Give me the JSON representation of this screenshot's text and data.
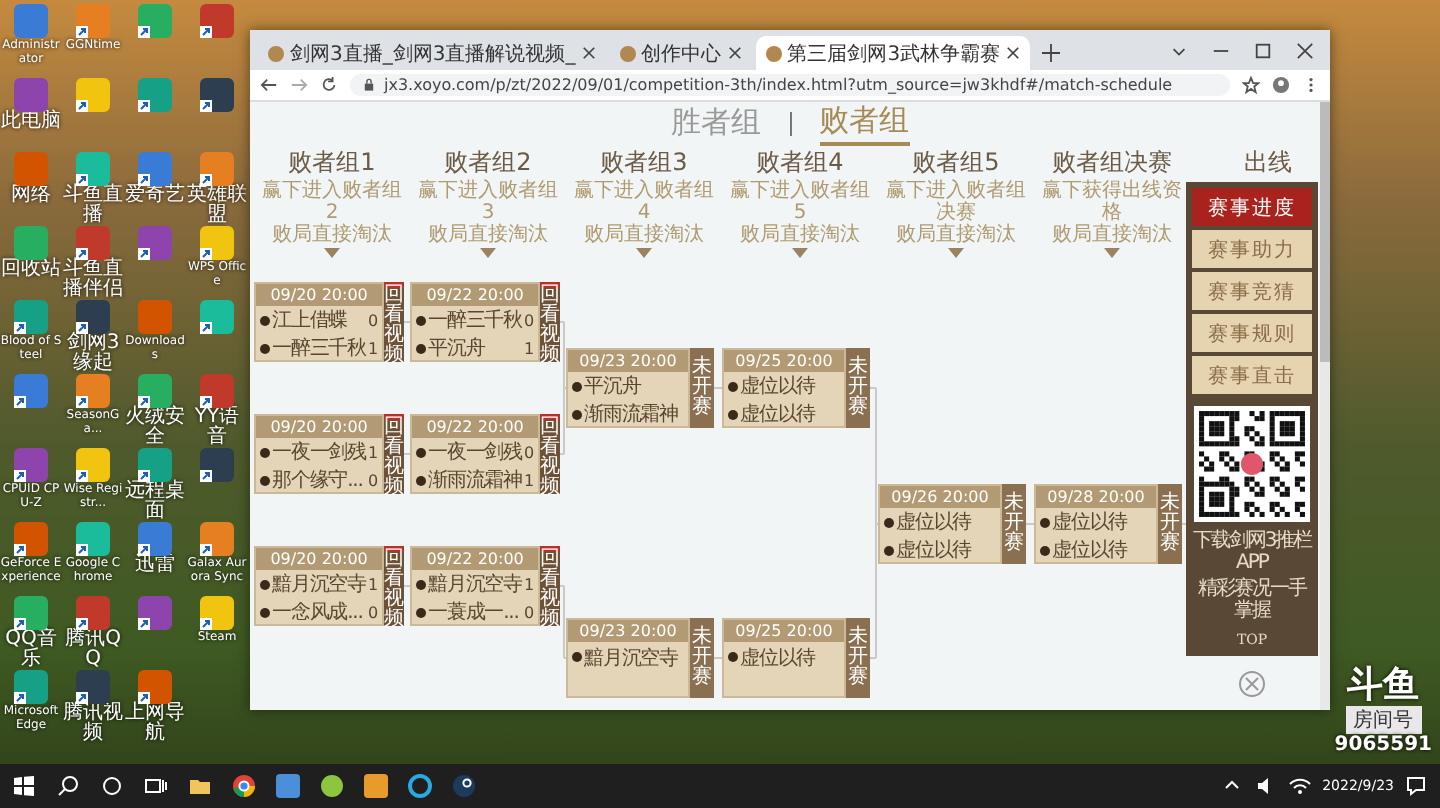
{
  "desktop": {
    "icons": [
      {
        "label": "Administrator",
        "shortcut": false
      },
      {
        "label": "GGNtime",
        "shortcut": true
      },
      {
        "shortcut": true
      },
      {
        "shortcut": true
      },
      {
        "label": "此电脑",
        "shortcut": false
      },
      {
        "shortcut": true
      },
      {
        "shortcut": true
      },
      {
        "shortcut": true
      },
      {
        "label": "网络",
        "shortcut": false
      },
      {
        "label": "斗鱼直播",
        "shortcut": true
      },
      {
        "label": "爱奇艺",
        "shortcut": true
      },
      {
        "label": "英雄联盟",
        "shortcut": true
      },
      {
        "label": "回收站",
        "shortcut": false
      },
      {
        "label": "斗鱼直播伴侣",
        "shortcut": true
      },
      {
        "shortcut": true
      },
      {
        "label": "WPS Office",
        "shortcut": true
      },
      {
        "label": "Blood of Steel",
        "shortcut": true
      },
      {
        "label": "剑网3缘起",
        "shortcut": true
      },
      {
        "label": "Downloads",
        "shortcut": false
      },
      {
        "shortcut": true
      },
      {
        "shortcut": true
      },
      {
        "label": "SeasonGa...",
        "shortcut": true
      },
      {
        "label": "火绒安全",
        "shortcut": true
      },
      {
        "label": "YY语音",
        "shortcut": true
      },
      {
        "label": "CPUID CPU-Z",
        "shortcut": true
      },
      {
        "label": "Wise Registr...",
        "shortcut": true
      },
      {
        "label": "远程桌面",
        "shortcut": true
      },
      {
        "shortcut": true
      },
      {
        "label": "GeForce Experience",
        "shortcut": true
      },
      {
        "label": "Google Chrome",
        "shortcut": true
      },
      {
        "label": "迅雷",
        "shortcut": true
      },
      {
        "label": "Galax Aurora Sync",
        "shortcut": true
      },
      {
        "label": "QQ音乐",
        "shortcut": true
      },
      {
        "label": "腾讯QQ",
        "shortcut": true
      },
      {
        "shortcut": true
      },
      {
        "label": "Steam",
        "shortcut": true
      },
      {
        "label": "Microsoft Edge",
        "shortcut": true
      },
      {
        "label": "腾讯视频",
        "shortcut": true
      },
      {
        "label": "上网导航",
        "shortcut": true
      }
    ]
  },
  "browser": {
    "tabs": [
      {
        "title": "剑网3直播_剑网3直播解说视频_",
        "selected": false
      },
      {
        "title": "创作中心",
        "selected": false
      },
      {
        "title": "第三届剑网3武林争霸赛",
        "selected": true
      }
    ],
    "url": "jx3.xoyo.com/p/zt/2022/09/01/competition-3th/index.html?utm_source=jw3khdf#/match-schedule",
    "page": {
      "groups": [
        {
          "label": "胜者组",
          "selected": false
        },
        {
          "label": "败者组",
          "selected": true
        }
      ],
      "rounds": [
        {
          "title": "败者组1",
          "note": [
            "赢下进入败者组2",
            "败局直接淘汰"
          ],
          "matches": [
            {
              "time": "09/20 20:00",
              "kind": "played",
              "tag": "回看视频",
              "teams": [
                {
                  "name": "江上借蝶",
                  "score": "0"
                },
                {
                  "name": "一醉三千秋",
                  "score": "1"
                }
              ]
            },
            {
              "time": "09/20 20:00",
              "kind": "played",
              "tag": "回看视频",
              "teams": [
                {
                  "name": "一夜一剑残",
                  "score": "1"
                },
                {
                  "name": "那个缘守...",
                  "score": "0"
                }
              ]
            },
            {
              "time": "09/20 20:00",
              "kind": "played",
              "tag": "回看视频",
              "teams": [
                {
                  "name": "黯月沉空寺",
                  "score": "1"
                },
                {
                  "name": "一念风成...",
                  "score": "0"
                }
              ]
            }
          ]
        },
        {
          "title": "败者组2",
          "note": [
            "赢下进入败者组3",
            "败局直接淘汰"
          ],
          "matches": [
            {
              "time": "09/22 20:00",
              "kind": "played",
              "tag": "回看视频",
              "teams": [
                {
                  "name": "一醉三千秋",
                  "score": "0"
                },
                {
                  "name": "平沉舟",
                  "score": "1"
                }
              ]
            },
            {
              "time": "09/22 20:00",
              "kind": "played",
              "tag": "回看视频",
              "teams": [
                {
                  "name": "一夜一剑残",
                  "score": "0"
                },
                {
                  "name": "渐雨流霜神",
                  "score": "1"
                }
              ]
            },
            {
              "time": "09/22 20:00",
              "kind": "played",
              "tag": "回看视频",
              "teams": [
                {
                  "name": "黯月沉空寺",
                  "score": "1"
                },
                {
                  "name": "一蓑成一...",
                  "score": "0"
                }
              ]
            }
          ]
        },
        {
          "title": "败者组3",
          "note": [
            "赢下进入败者组4",
            "败局直接淘汰"
          ],
          "matches": [
            {
              "time": "09/23 20:00",
              "kind": "upcoming",
              "tag": "未开赛",
              "teams": [
                {
                  "name": "平沉舟"
                },
                {
                  "name": "渐雨流霜神"
                }
              ]
            },
            {
              "time": "09/23 20:00",
              "kind": "upcoming",
              "tag": "未开赛",
              "teams": [
                {
                  "name": "黯月沉空寺"
                }
              ]
            }
          ]
        },
        {
          "title": "败者组4",
          "note": [
            "赢下进入败者组5",
            "败局直接淘汰"
          ],
          "matches": [
            {
              "time": "09/25 20:00",
              "kind": "upcoming",
              "tag": "未开赛",
              "teams": [
                {
                  "name": "虚位以待"
                },
                {
                  "name": "虚位以待"
                }
              ]
            },
            {
              "time": "09/25 20:00",
              "kind": "upcoming",
              "tag": "未开赛",
              "teams": [
                {
                  "name": "虚位以待"
                }
              ]
            }
          ]
        },
        {
          "title": "败者组5",
          "note": [
            "赢下进入败者组决赛",
            "败局直接淘汰"
          ],
          "matches": [
            {
              "time": "09/26 20:00",
              "kind": "upcoming",
              "tag": "未开赛",
              "teams": [
                {
                  "name": "虚位以待"
                },
                {
                  "name": "虚位以待"
                }
              ]
            }
          ]
        },
        {
          "title": "败者组决赛",
          "note": [
            "赢下获得出线资格",
            "败局直接淘汰"
          ],
          "matches": [
            {
              "time": "09/28 20:00",
              "kind": "upcoming",
              "tag": "未开赛",
              "teams": [
                {
                  "name": "虚位以待"
                },
                {
                  "name": "虚位以待"
                }
              ]
            }
          ]
        },
        {
          "title": "出线"
        }
      ],
      "side_menu": {
        "items": [
          {
            "label": "赛事进度",
            "selected": true
          },
          {
            "label": "赛事助力",
            "selected": false
          },
          {
            "label": "赛事竞猜",
            "selected": false
          },
          {
            "label": "赛事规则",
            "selected": false
          },
          {
            "label": "赛事直击",
            "selected": false
          }
        ],
        "caption": [
          "下载剑网3推栏APP",
          "精彩赛况一手掌握"
        ],
        "top_label": "TOP"
      }
    }
  },
  "taskbar": {
    "date": "2022/9/23"
  },
  "stream_badge": {
    "logo": "斗鱼",
    "room_label": "房间号",
    "room_number": "9065591"
  }
}
